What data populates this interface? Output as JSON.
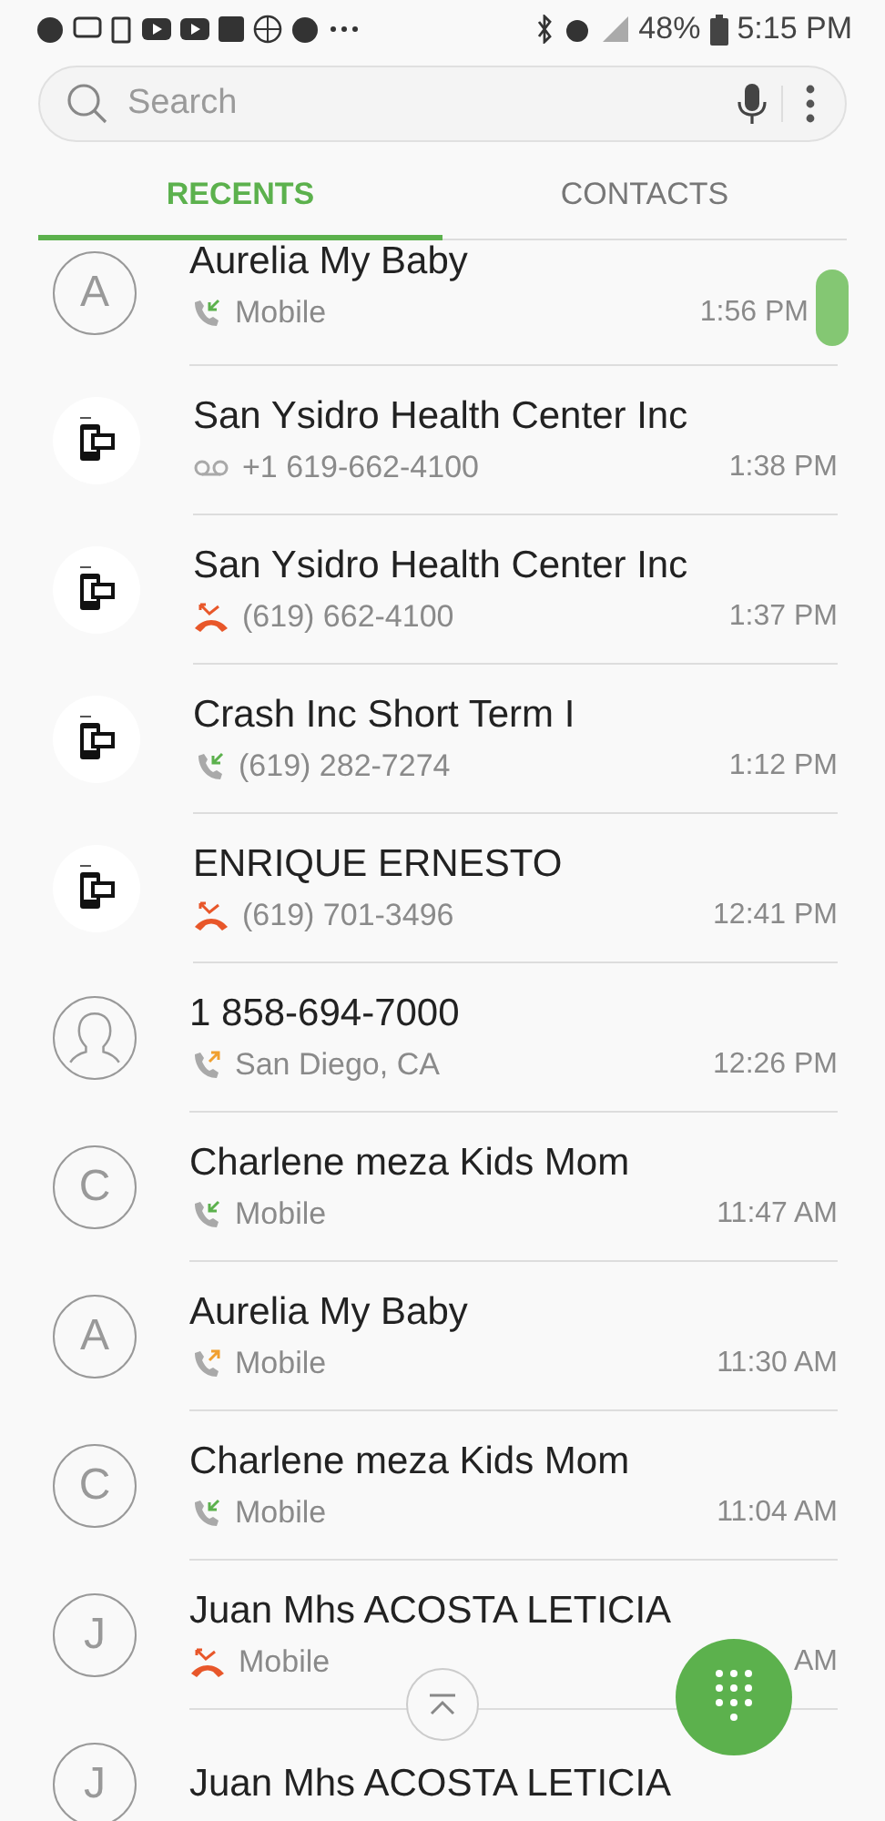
{
  "status_bar": {
    "battery": "48%",
    "time": "5:15 PM"
  },
  "search": {
    "placeholder": "Search"
  },
  "tabs": [
    {
      "label": "RECENTS",
      "selected": true
    },
    {
      "label": "CONTACTS",
      "selected": false
    }
  ],
  "calls": [
    {
      "name": "Aurelia My Baby",
      "avatar": {
        "kind": "letter",
        "initial": "A"
      },
      "call": {
        "kind": "incoming"
      },
      "detail": "Mobile",
      "time": "1:56 PM"
    },
    {
      "name": "San Ysidro Health Center Inc",
      "avatar": {
        "kind": "callerid"
      },
      "call": {
        "kind": "voicemail"
      },
      "detail": "+1 619-662-4100",
      "time": "1:38 PM"
    },
    {
      "name": "San Ysidro Health Center Inc",
      "avatar": {
        "kind": "callerid"
      },
      "call": {
        "kind": "missed"
      },
      "detail": "(619) 662-4100",
      "time": "1:37 PM"
    },
    {
      "name": "Crash Inc Short Term I",
      "avatar": {
        "kind": "callerid"
      },
      "call": {
        "kind": "incoming"
      },
      "detail": "(619) 282-7274",
      "time": "1:12 PM"
    },
    {
      "name": "ENRIQUE ERNESTO",
      "avatar": {
        "kind": "callerid"
      },
      "call": {
        "kind": "missed"
      },
      "detail": "(619) 701-3496",
      "time": "12:41 PM"
    },
    {
      "name": "1 858-694-7000",
      "avatar": {
        "kind": "person"
      },
      "call": {
        "kind": "outgoing"
      },
      "detail": "San Diego, CA",
      "time": "12:26 PM"
    },
    {
      "name": "Charlene meza Kids Mom",
      "avatar": {
        "kind": "letter",
        "initial": "C"
      },
      "call": {
        "kind": "incoming"
      },
      "detail": "Mobile",
      "time": "11:47 AM"
    },
    {
      "name": "Aurelia My Baby",
      "avatar": {
        "kind": "letter",
        "initial": "A"
      },
      "call": {
        "kind": "outgoing"
      },
      "detail": "Mobile",
      "time": "11:30 AM"
    },
    {
      "name": "Charlene meza Kids Mom",
      "avatar": {
        "kind": "letter",
        "initial": "C"
      },
      "call": {
        "kind": "incoming"
      },
      "detail": "Mobile",
      "time": "11:04 AM"
    },
    {
      "name": "Juan Mhs ACOSTA LETICIA",
      "avatar": {
        "kind": "letter",
        "initial": "J"
      },
      "call": {
        "kind": "missed"
      },
      "detail": "Mobile",
      "time": "AM"
    },
    {
      "name": "Juan Mhs ACOSTA LETICIA",
      "avatar": {
        "kind": "letter",
        "initial": "J"
      }
    }
  ]
}
